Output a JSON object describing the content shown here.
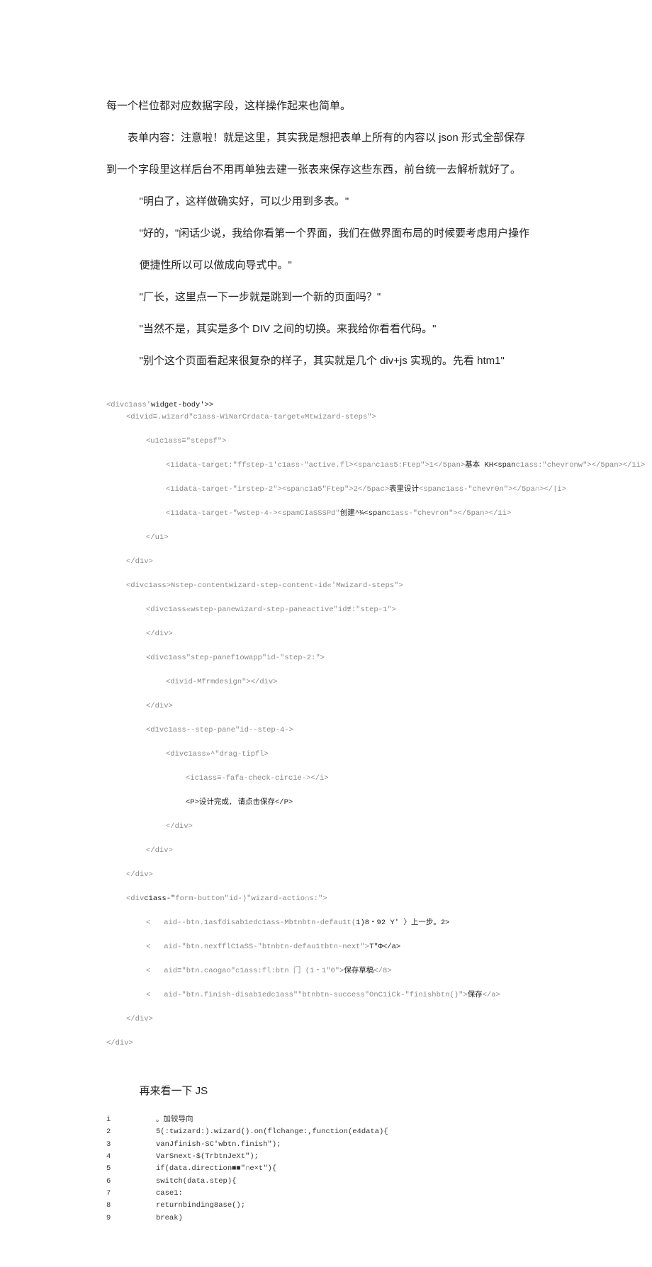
{
  "para1": "每一个栏位都对应数据字段，这样操作起来也简单。",
  "para2": "表单内容：注意啦！就是这里，其实我是想把表单上所有的内容以 json 形式全部保存",
  "para3": "到一个字段里这样后台不用再单独去建一张表来保存这些东西，前台统一去解析就好了。",
  "para4": "\"明白了，这样做确实好，可以少用到多表。\"",
  "para5": "\"好的，\"闲话少说，我给你看第一个界面，我们在做界面布局的时候要考虑用户操作",
  "para6": "便捷性所以可以做成向导式中。\"",
  "para7": "\"厂长，这里点一下一步就是跳到一个新的页面吗？\"",
  "para8": "\"当然不是，其实是多个 DIV 之间的切换。来我给你看看代码。\"",
  "para9": "\"别个这个页面看起来很复杂的样子，其实就是几个 div+js 实现的。先看 htm1\"",
  "code": {
    "l1a": "<divc1ass'",
    "l1b": "widget-body'>>",
    "l2": "<divid≡.wizard\"c1ass-WiNarCrdata-target«Mtwizard-steps\">",
    "l3": "<u1c1ass≡\"stepsf\">",
    "l4a": "<1idata-target:\"ffstep-1'c1ass-\"active.fl><spa∩c1as5:Ftep\">1</5pan>",
    "l4b": "基本 KH<span",
    "l4c": "c1ass:\"chevronw\"></5pan></1i>",
    "l5a": "<1idata-target-\"irstep-2\"><spa∩c1a5\"Ftep\">2</5pac>",
    "l5b": "表里设计",
    "l5c": "<spanc1ass-\"chevr0n\"></5pa∩></|i>",
    "l6a": "<11data-target-\"wstep-4-><spamCIaSSSPd\"",
    "l6b": "创建^¼<span",
    "l6c": "c1ass-\"chevron\"></5pan></1i>",
    "l7": "</u1>",
    "l8": "</d1v>",
    "l9": "<divc1ass>Nstep-contentwizard-step-content-id«'Mwizard-steps\">",
    "l10": "<divc1ass«wstep-panewizard-step-paneactive\"id≢:\"step-1\">",
    "l11": "</div>",
    "l12": "<divc1ass\"step-panef1owapp\"id-\"step-2:\">",
    "l13": "<divid-Mfrmdesign\"></div>",
    "l14": "</div>",
    "l15": "<d1vc1ass--step-pane\"id--step-4->",
    "l16": "<divc1ass»^\"drag-tipfl>",
    "l17": "<ic1ass≡-fafa-check-circ1e-></i>",
    "l18": "<P>设计完成, 请点击保存</P>",
    "l19": "</div>",
    "l20": "</div>",
    "l21": "</div>",
    "l22a": "<div",
    "l22b": "c1ass-\"",
    "l22c": "form-button\"id-)\"wizard-actio∩s:\">",
    "l23a": "<   aid--btn.1asfdisab1edc1ass-Mbtnbtn-defau1t(",
    "l23b": "1)8・92 Y' 〉上一步。2>",
    "l24a": "<   aid-\"btn.nexfflC1aSS-\"btnbtn-defau1tbtn-next\">",
    "l24b": "T\"Φ</a>",
    "l25a": "<   aid≡\"btn.caogao\"c1ass:fl:btn 门 (1・1\"0\">",
    "l25b": "保存草稿",
    "l25c": "</8>",
    "l26a": "<   aid-\"btn.finish-disab1edc1ass\"\"btnbtn-success\"OnC1iCk-\"finishbtn()\">",
    "l26b": "保存",
    "l26c": "</a>",
    "l27": "</div>",
    "l28": "</div>"
  },
  "jstitle": "再来看一下 JS",
  "js": [
    {
      "n": "i",
      "c": "。加较导向"
    },
    {
      "n": "2",
      "c": "5(:twizard:).wizard().on(flchange:,function(e4data){"
    },
    {
      "n": "3",
      "c": "vanJfinish-SC'wbtn.finish\");"
    },
    {
      "n": "4",
      "c": "VarSnext-$(TrbtnJeXt\");"
    },
    {
      "n": "5",
      "c": "if(data.direction■■\"∩e×t\"){"
    },
    {
      "n": "6",
      "c": "switch(data.step){"
    },
    {
      "n": "7",
      "c": "case1:"
    },
    {
      "n": "8",
      "c": "returnbinding8ase();"
    },
    {
      "n": "9",
      "c": "break)"
    }
  ]
}
